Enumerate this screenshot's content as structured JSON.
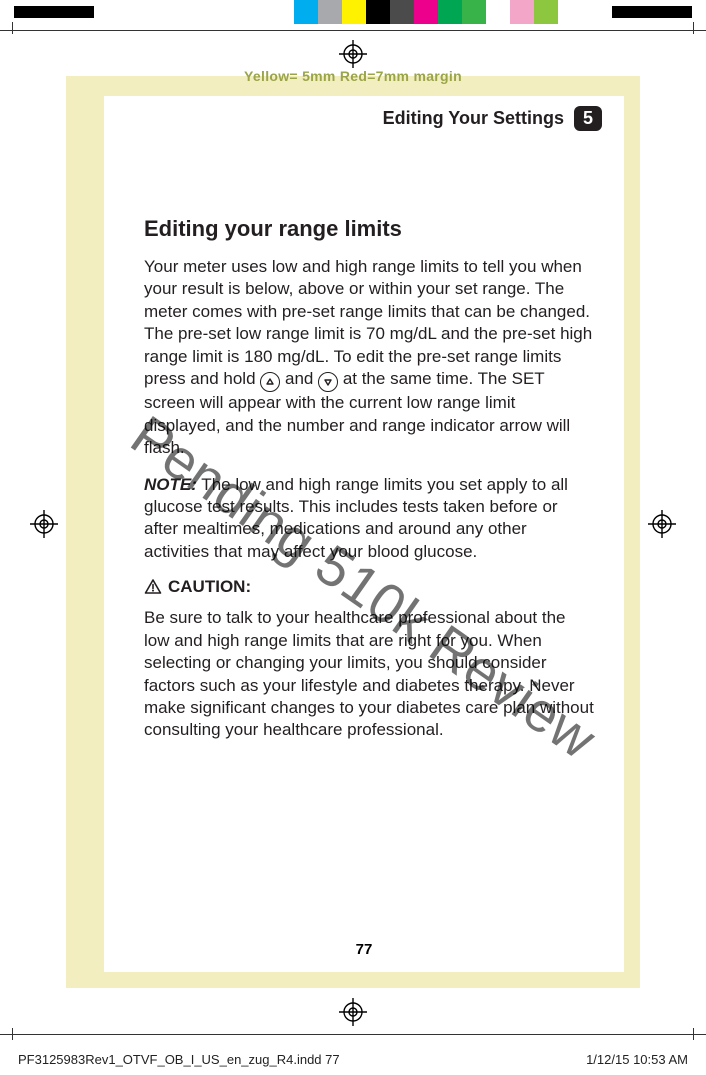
{
  "colorbar": {
    "swatches": [
      "#00aeef",
      "#a7a9ac",
      "#fff200",
      "#000000",
      "#4b4b4b",
      "#ec008c",
      "#00a651",
      "#37b34a",
      "#ffffff",
      "#f4a6c9",
      "#8dc63f",
      "#ffffff"
    ]
  },
  "margin_note": "Yellow= 5mm  Red=7mm margin",
  "running_head": {
    "title": "Editing Your Settings",
    "chapter_number": "5"
  },
  "section_heading": "Editing your range limits",
  "paragraphs": {
    "p1a": "Your meter uses low and high range limits to tell you when your result is below, above or within your set range. The meter comes with pre-set range limits that can be changed. The pre-set low range limit is 70 mg/dL and the pre-set high range limit is 180 mg/dL. To edit the pre-set range limits press and hold ",
    "p1b": " and ",
    "p1c": " at the same time. The SET screen will appear with the current low range limit displayed, and the number and range indicator arrow will flash.",
    "note_label": "NOTE:",
    "p2": " The low and high range limits you set apply to all glucose test results. This includes tests taken before or after mealtimes, medications and around any other activities that may affect your blood glucose.",
    "caution_label": "CAUTION:",
    "p3": "Be sure to talk to your healthcare professional about the low and high range limits that are right for you. When selecting or changing your limits, you should consider factors such as your lifestyle and diabetes therapy. Never make significant changes to your diabetes care plan without consulting your healthcare professional."
  },
  "watermark": "Pending 510k Review",
  "page_number": "77",
  "slug": {
    "file": "PF3125983Rev1_OTVF_OB_I_US_en_zug_R4.indd   77",
    "timestamp": "1/12/15   10:53 AM"
  }
}
